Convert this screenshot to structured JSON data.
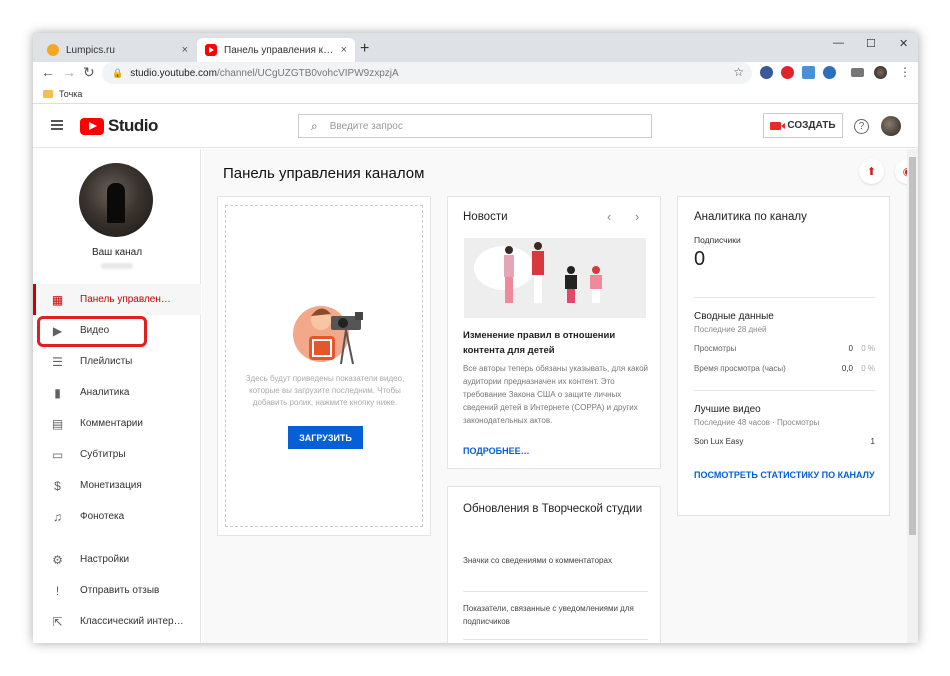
{
  "browser": {
    "tabs": [
      {
        "title": "Lumpics.ru",
        "close": "×"
      },
      {
        "title": "Панель управления каналом - YouTube Studio",
        "close": "×"
      }
    ],
    "new_tab": "+",
    "window_controls": [
      "—",
      "☐",
      "✕"
    ],
    "url_host": "studio.youtube.com",
    "url_path": "/channel/UCgUZGTB0vohcVIPW9zxpzjA",
    "bookmark": "Точка"
  },
  "studio": {
    "logo_text": "Studio",
    "search_placeholder": "Введите запрос",
    "create_label": "СОЗДАТЬ",
    "help": "?"
  },
  "sidebar": {
    "channel_name": "Ваш канал",
    "items": [
      {
        "label": "Панель управлен…",
        "icon": "dashboard-icon",
        "active": true
      },
      {
        "label": "Видео",
        "icon": "video-icon"
      },
      {
        "label": "Плейлисты",
        "icon": "playlist-icon"
      },
      {
        "label": "Аналитика",
        "icon": "analytics-icon"
      },
      {
        "label": "Комментарии",
        "icon": "comment-icon"
      },
      {
        "label": "Субтитры",
        "icon": "subtitles-icon"
      },
      {
        "label": "Монетизация",
        "icon": "dollar-icon"
      },
      {
        "label": "Фонотека",
        "icon": "audio-library-icon"
      },
      {
        "label": "Настройки",
        "icon": "gear-icon"
      },
      {
        "label": "Отправить отзыв",
        "icon": "feedback-icon"
      },
      {
        "label": "Классический интер…",
        "icon": "classic-icon"
      }
    ]
  },
  "main": {
    "title": "Панель управления каналом",
    "upload_card": {
      "text": "Здесь будут приведены показатели видео, которые вы загрузите последним. Чтобы добавить ролик, нажмите кнопку ниже.",
      "button": "ЗАГРУЗИТЬ"
    },
    "news": {
      "title": "Новости",
      "headline": "Изменение правил в отношении контента для детей",
      "body": "Все авторы теперь обязаны указывать, для какой аудитории предназначен их контент. Это требование Закона США о защите личных сведений детей в Интернете (COPPA) и других законодательных актов.",
      "link": "ПОДРОБНЕЕ…"
    },
    "updates": {
      "title": "Обновления в Творческой студии",
      "items": [
        "Значки со сведениями о комментаторах",
        "Показатели, связанные с уведомлениями для подписчиков"
      ]
    },
    "analytics": {
      "title": "Аналитика по каналу",
      "subs_label": "Подписчики",
      "subs_value": "0",
      "summary_title": "Сводные данные",
      "summary_period": "Последние 28 дней",
      "rows": [
        {
          "label": "Просмотры",
          "value": "0",
          "pct": "0 %"
        },
        {
          "label": "Время просмотра (часы)",
          "value": "0,0",
          "pct": "0 %"
        }
      ],
      "top_title": "Лучшие видео",
      "top_period": "Последние 48 часов · Просмотры",
      "top_video": "Son Lux Easy",
      "top_views": "1",
      "link": "ПОСМОТРЕТЬ СТАТИСТИКУ ПО КАНАЛУ"
    }
  }
}
